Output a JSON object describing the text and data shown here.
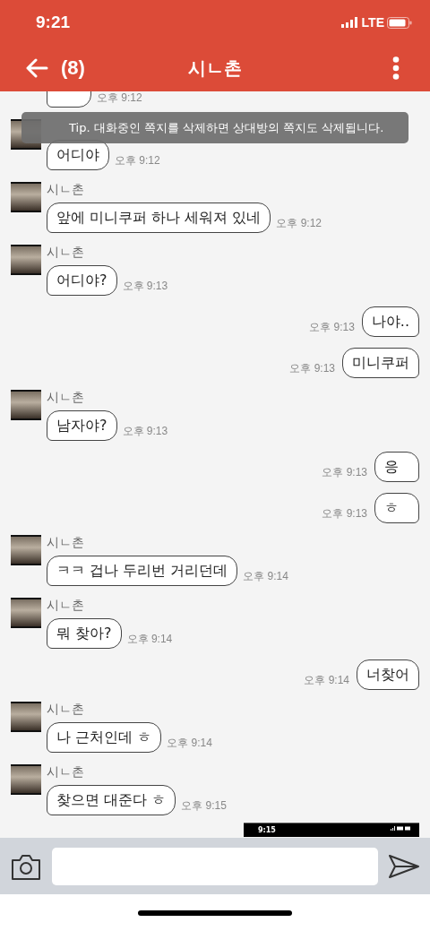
{
  "status_bar": {
    "time": "9:21",
    "network": "LTE"
  },
  "header": {
    "back_count": "(8)",
    "title": "시ㄴ촌"
  },
  "toast": {
    "text": "Tip. 대화중인 쪽지를 삭제하면 상대방의 쪽지도 삭제됩니다."
  },
  "messages": [
    {
      "kind": "cut",
      "time": "오후 9:12"
    },
    {
      "kind": "incoming",
      "text": "어디야",
      "time": "오후 9:12"
    },
    {
      "kind": "incoming",
      "name": "시ㄴ촌",
      "text": "앞에 미니쿠퍼 하나 세워져 있네",
      "time": "오후 9:12"
    },
    {
      "kind": "incoming",
      "name": "시ㄴ촌",
      "text": "어디야?",
      "time": "오후 9:13"
    },
    {
      "kind": "outgoing",
      "text": "나야..",
      "time": "오후 9:13"
    },
    {
      "kind": "outgoing",
      "text": "미니쿠퍼",
      "time": "오후 9:13"
    },
    {
      "kind": "incoming",
      "name": "시ㄴ촌",
      "text": "남자야?",
      "time": "오후 9:13"
    },
    {
      "kind": "outgoing",
      "text": "응",
      "time": "오후 9:13"
    },
    {
      "kind": "outgoing",
      "text": "ㅎ",
      "time": "오후 9:13"
    },
    {
      "kind": "incoming",
      "name": "시ㄴ촌",
      "text": "ㅋㅋ 겁나 두리번 거리던데",
      "time": "오후 9:14"
    },
    {
      "kind": "incoming",
      "name": "시ㄴ촌",
      "text": "뭐 찾아?",
      "time": "오후 9:14"
    },
    {
      "kind": "outgoing",
      "text": "너찾어",
      "time": "오후 9:14"
    },
    {
      "kind": "incoming",
      "name": "시ㄴ촌",
      "text": "나 근처인데 ㅎ",
      "time": "오후 9:14"
    },
    {
      "kind": "incoming",
      "name": "시ㄴ촌",
      "text": "찾으면 대준다 ㅎ",
      "time": "오후 9:15"
    },
    {
      "kind": "image",
      "time": "9:15"
    }
  ]
}
